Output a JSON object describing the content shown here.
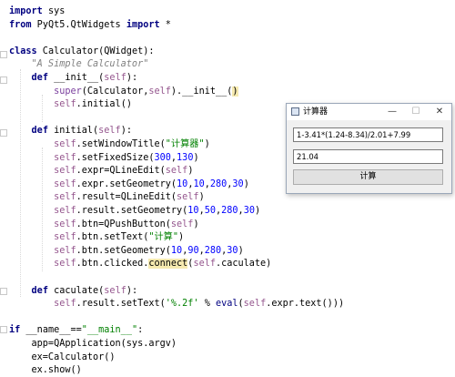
{
  "colors": {
    "keyword": "#000080",
    "string": "#008000",
    "self": "#94558d",
    "number": "#0000ff",
    "builtin": "#000080",
    "docstring": "#808080",
    "super": "#7a3e9d",
    "highlight": "#f6eab0",
    "plain": "#000000"
  },
  "code_lines": [
    {
      "tokens": [
        {
          "t": "import",
          "c": "keyword"
        },
        {
          "t": " sys",
          "c": "plain"
        }
      ]
    },
    {
      "tokens": [
        {
          "t": "from",
          "c": "keyword"
        },
        {
          "t": " PyQt5.QtWidgets ",
          "c": "plain"
        },
        {
          "t": "import",
          "c": "keyword"
        },
        {
          "t": " *",
          "c": "plain"
        }
      ]
    },
    {
      "tokens": []
    },
    {
      "tokens": [
        {
          "t": "class",
          "c": "keyword"
        },
        {
          "t": " Calculator(QWidget):",
          "c": "plain"
        }
      ]
    },
    {
      "tokens": [
        {
          "t": "    \"A Simple Calculator\"",
          "c": "docstring"
        }
      ]
    },
    {
      "tokens": [
        {
          "t": "    ",
          "c": "plain"
        },
        {
          "t": "def",
          "c": "keyword"
        },
        {
          "t": " __init__(",
          "c": "plain"
        },
        {
          "t": "self",
          "c": "self"
        },
        {
          "t": "):",
          "c": "plain"
        }
      ]
    },
    {
      "tokens": [
        {
          "t": "        ",
          "c": "plain"
        },
        {
          "t": "super",
          "c": "super"
        },
        {
          "t": "(Calculator,",
          "c": "plain"
        },
        {
          "t": "self",
          "c": "self"
        },
        {
          "t": ").__init__(",
          "c": "plain"
        },
        {
          "t": ")",
          "c": "highlight"
        }
      ]
    },
    {
      "tokens": [
        {
          "t": "        ",
          "c": "plain"
        },
        {
          "t": "self",
          "c": "self"
        },
        {
          "t": ".initial()",
          "c": "plain"
        }
      ]
    },
    {
      "tokens": []
    },
    {
      "tokens": [
        {
          "t": "    ",
          "c": "plain"
        },
        {
          "t": "def",
          "c": "keyword"
        },
        {
          "t": " initial(",
          "c": "plain"
        },
        {
          "t": "self",
          "c": "self"
        },
        {
          "t": "):",
          "c": "plain"
        }
      ]
    },
    {
      "tokens": [
        {
          "t": "        ",
          "c": "plain"
        },
        {
          "t": "self",
          "c": "self"
        },
        {
          "t": ".setWindowTitle(",
          "c": "plain"
        },
        {
          "t": "\"计算器\"",
          "c": "string"
        },
        {
          "t": ")",
          "c": "plain"
        }
      ]
    },
    {
      "tokens": [
        {
          "t": "        ",
          "c": "plain"
        },
        {
          "t": "self",
          "c": "self"
        },
        {
          "t": ".setFixedSize(",
          "c": "plain"
        },
        {
          "t": "300",
          "c": "number"
        },
        {
          "t": ",",
          "c": "plain"
        },
        {
          "t": "130",
          "c": "number"
        },
        {
          "t": ")",
          "c": "plain"
        }
      ]
    },
    {
      "tokens": [
        {
          "t": "        ",
          "c": "plain"
        },
        {
          "t": "self",
          "c": "self"
        },
        {
          "t": ".expr=QLineEdit(",
          "c": "plain"
        },
        {
          "t": "self",
          "c": "self"
        },
        {
          "t": ")",
          "c": "plain"
        }
      ]
    },
    {
      "tokens": [
        {
          "t": "        ",
          "c": "plain"
        },
        {
          "t": "self",
          "c": "self"
        },
        {
          "t": ".expr.setGeometry(",
          "c": "plain"
        },
        {
          "t": "10",
          "c": "number"
        },
        {
          "t": ",",
          "c": "plain"
        },
        {
          "t": "10",
          "c": "number"
        },
        {
          "t": ",",
          "c": "plain"
        },
        {
          "t": "280",
          "c": "number"
        },
        {
          "t": ",",
          "c": "plain"
        },
        {
          "t": "30",
          "c": "number"
        },
        {
          "t": ")",
          "c": "plain"
        }
      ]
    },
    {
      "tokens": [
        {
          "t": "        ",
          "c": "plain"
        },
        {
          "t": "self",
          "c": "self"
        },
        {
          "t": ".result=QLineEdit(",
          "c": "plain"
        },
        {
          "t": "self",
          "c": "self"
        },
        {
          "t": ")",
          "c": "plain"
        }
      ]
    },
    {
      "tokens": [
        {
          "t": "        ",
          "c": "plain"
        },
        {
          "t": "self",
          "c": "self"
        },
        {
          "t": ".result.setGeometry(",
          "c": "plain"
        },
        {
          "t": "10",
          "c": "number"
        },
        {
          "t": ",",
          "c": "plain"
        },
        {
          "t": "50",
          "c": "number"
        },
        {
          "t": ",",
          "c": "plain"
        },
        {
          "t": "280",
          "c": "number"
        },
        {
          "t": ",",
          "c": "plain"
        },
        {
          "t": "30",
          "c": "number"
        },
        {
          "t": ")",
          "c": "plain"
        }
      ]
    },
    {
      "tokens": [
        {
          "t": "        ",
          "c": "plain"
        },
        {
          "t": "self",
          "c": "self"
        },
        {
          "t": ".btn=QPushButton(",
          "c": "plain"
        },
        {
          "t": "self",
          "c": "self"
        },
        {
          "t": ")",
          "c": "plain"
        }
      ]
    },
    {
      "tokens": [
        {
          "t": "        ",
          "c": "plain"
        },
        {
          "t": "self",
          "c": "self"
        },
        {
          "t": ".btn.setText(",
          "c": "plain"
        },
        {
          "t": "\"计算\"",
          "c": "string"
        },
        {
          "t": ")",
          "c": "plain"
        }
      ]
    },
    {
      "tokens": [
        {
          "t": "        ",
          "c": "plain"
        },
        {
          "t": "self",
          "c": "self"
        },
        {
          "t": ".btn.setGeometry(",
          "c": "plain"
        },
        {
          "t": "10",
          "c": "number"
        },
        {
          "t": ",",
          "c": "plain"
        },
        {
          "t": "90",
          "c": "number"
        },
        {
          "t": ",",
          "c": "plain"
        },
        {
          "t": "280",
          "c": "number"
        },
        {
          "t": ",",
          "c": "plain"
        },
        {
          "t": "30",
          "c": "number"
        },
        {
          "t": ")",
          "c": "plain"
        }
      ]
    },
    {
      "tokens": [
        {
          "t": "        ",
          "c": "plain"
        },
        {
          "t": "self",
          "c": "self"
        },
        {
          "t": ".btn.clicked.",
          "c": "plain"
        },
        {
          "t": "connect",
          "c": "highlight"
        },
        {
          "t": "(",
          "c": "plain"
        },
        {
          "t": "self",
          "c": "self"
        },
        {
          "t": ".caculate)",
          "c": "plain"
        }
      ]
    },
    {
      "tokens": []
    },
    {
      "tokens": [
        {
          "t": "    ",
          "c": "plain"
        },
        {
          "t": "def",
          "c": "keyword"
        },
        {
          "t": " caculate(",
          "c": "plain"
        },
        {
          "t": "self",
          "c": "self"
        },
        {
          "t": "):",
          "c": "plain"
        }
      ]
    },
    {
      "tokens": [
        {
          "t": "        ",
          "c": "plain"
        },
        {
          "t": "self",
          "c": "self"
        },
        {
          "t": ".result.setText(",
          "c": "plain"
        },
        {
          "t": "'%.2f'",
          "c": "string"
        },
        {
          "t": " % ",
          "c": "plain"
        },
        {
          "t": "eval",
          "c": "builtin"
        },
        {
          "t": "(",
          "c": "plain"
        },
        {
          "t": "self",
          "c": "self"
        },
        {
          "t": ".expr.text()))",
          "c": "plain"
        }
      ]
    },
    {
      "tokens": []
    },
    {
      "tokens": [
        {
          "t": "if",
          "c": "keyword"
        },
        {
          "t": " __name__==",
          "c": "plain"
        },
        {
          "t": "\"__main__\"",
          "c": "string"
        },
        {
          "t": ":",
          "c": "plain"
        }
      ]
    },
    {
      "tokens": [
        {
          "t": "    app=QApplication(sys.argv)",
          "c": "plain"
        }
      ]
    },
    {
      "tokens": [
        {
          "t": "    ex=Calculator()",
          "c": "plain"
        }
      ]
    },
    {
      "tokens": [
        {
          "t": "    ex.show()",
          "c": "plain"
        }
      ]
    }
  ],
  "calc_window": {
    "title": "计算器",
    "minimize_glyph": "—",
    "maximize_glyph": "☐",
    "close_glyph": "✕",
    "expr_value": "1-3.41*(1.24-8.34)/2.01+7.99",
    "result_value": "21.04",
    "button_label": "计算"
  }
}
